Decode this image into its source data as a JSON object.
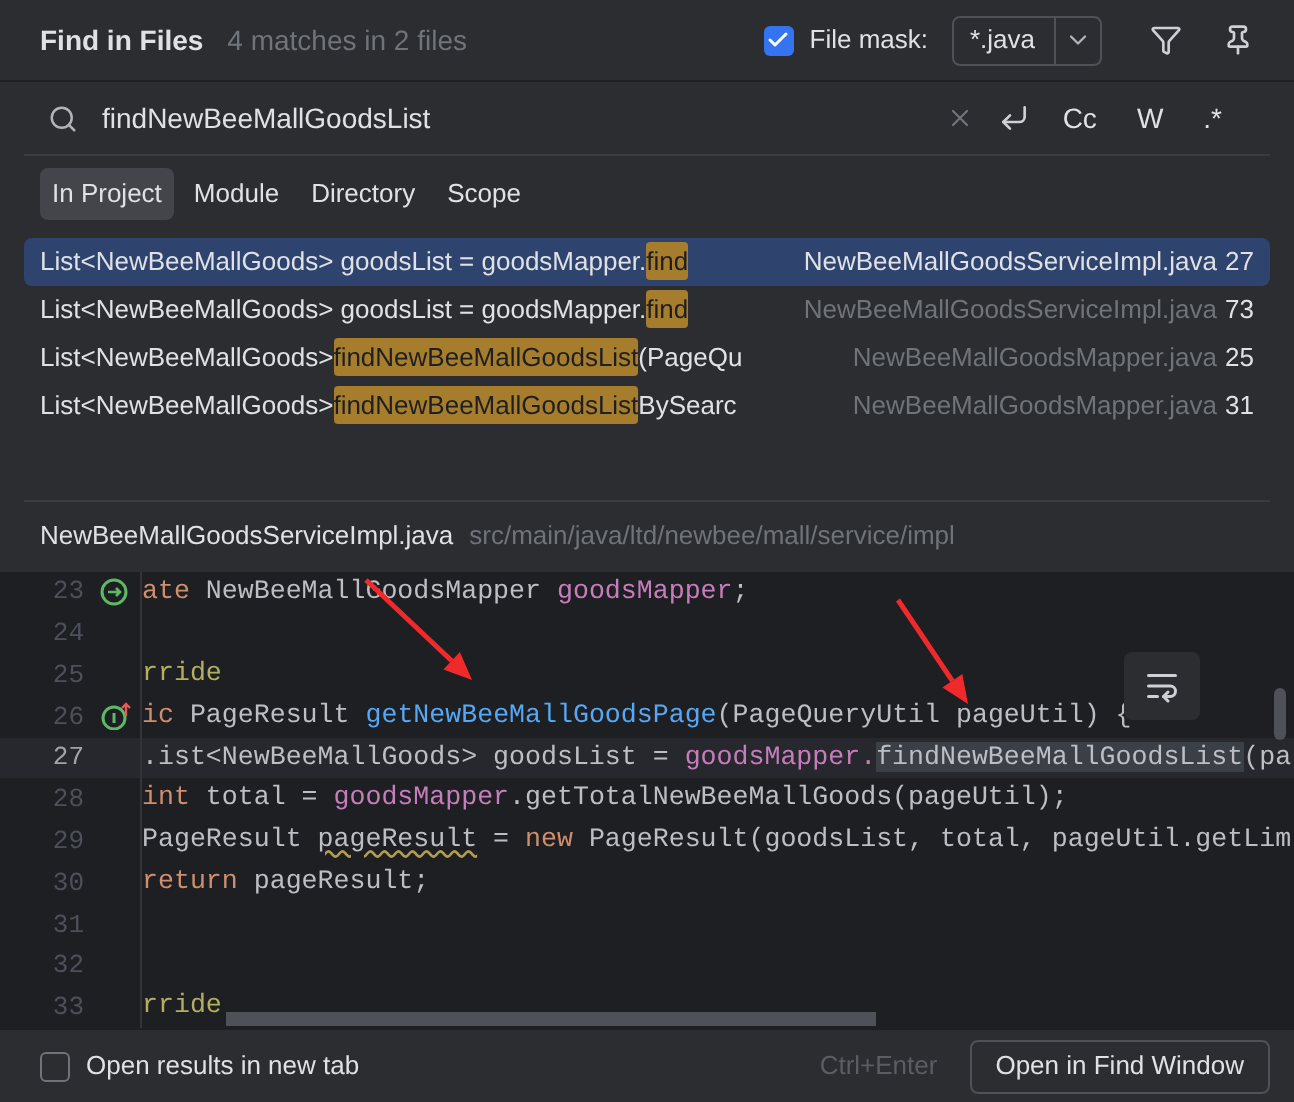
{
  "header": {
    "title": "Find in Files",
    "summary": "4 matches in 2 files",
    "file_mask": {
      "label": "File mask:",
      "checked": true,
      "value": "*.java"
    }
  },
  "search": {
    "value": "findNewBeeMallGoodsList",
    "options": [
      {
        "label": "Cc",
        "selected": false
      },
      {
        "label": "W",
        "selected": false
      },
      {
        "label": ".*",
        "selected": false
      }
    ]
  },
  "scopes": [
    {
      "label": "In Project",
      "selected": true
    },
    {
      "label": "Module",
      "selected": false
    },
    {
      "label": "Directory",
      "selected": false
    },
    {
      "label": "Scope",
      "selected": false
    }
  ],
  "results": [
    {
      "prefix": "List<NewBeeMallGoods> goodsList = goodsMapper.",
      "match": "find",
      "file": "NewBeeMallGoodsServiceImpl.java",
      "line": "27",
      "selected": true
    },
    {
      "prefix": "List<NewBeeMallGoods> goodsList = goodsMapper.",
      "match": "find",
      "file": "NewBeeMallGoodsServiceImpl.java",
      "line": "73",
      "selected": false
    },
    {
      "prefix": "List<NewBeeMallGoods> ",
      "match": "findNewBeeMallGoodsList",
      "suffix": "(PageQu",
      "file": "NewBeeMallGoodsMapper.java",
      "line": "25",
      "selected": false
    },
    {
      "prefix": "List<NewBeeMallGoods> ",
      "match": "findNewBeeMallGoodsList",
      "suffix": "BySearc",
      "file": "NewBeeMallGoodsMapper.java",
      "line": "31",
      "selected": false
    }
  ],
  "preview": {
    "file": "NewBeeMallGoodsServiceImpl.java",
    "path": "src/main/java/ltd/newbee/mall/service/impl",
    "lines": [
      {
        "number": "23",
        "current": false,
        "kind": "implements",
        "tokens": [
          {
            "kind": "keyword",
            "text": "ate "
          },
          {
            "kind": "plain",
            "text": "NewBeeMallGoodsMapper "
          },
          {
            "kind": "field",
            "text": "goodsMapper"
          },
          {
            "kind": "plain",
            "text": ";"
          }
        ]
      },
      {
        "number": "24",
        "current": false,
        "kind": "code"
      },
      {
        "number": "25",
        "current": false,
        "kind": "code",
        "tokens": [
          {
            "kind": "annotation",
            "text": "rride"
          }
        ]
      },
      {
        "number": "26",
        "current": false,
        "kind": "overrides",
        "tokens": [
          {
            "kind": "keyword",
            "text": "ic "
          },
          {
            "kind": "plain",
            "text": "PageResult "
          },
          {
            "kind": "method",
            "text": "getNewBeeMallGoodsPage"
          },
          {
            "kind": "plain",
            "text": "(PageQueryUtil pageUtil) {"
          }
        ]
      },
      {
        "number": "27",
        "current": true,
        "kind": "code",
        "tokens": [
          {
            "kind": "plain",
            "text": ".ist<NewBeeMallGoods> goodsList = "
          },
          {
            "kind": "field",
            "text": "goodsMapper."
          },
          {
            "kind": "match",
            "text": "findNewBeeMallGoodsList"
          },
          {
            "kind": "plain",
            "text": "(pa"
          }
        ]
      },
      {
        "number": "28",
        "current": false,
        "kind": "code",
        "tokens": [
          {
            "kind": "keyword",
            "text": "int "
          },
          {
            "kind": "plain",
            "text": "total = "
          },
          {
            "kind": "field",
            "text": "goodsMapper"
          },
          {
            "kind": "plain",
            "text": ".getTotalNewBeeMallGoods(pageUtil);"
          }
        ]
      },
      {
        "number": "29",
        "current": false,
        "kind": "code",
        "tokens": [
          {
            "kind": "plain",
            "text": "PageResult "
          },
          {
            "kind": "warning",
            "text": "pageResult"
          },
          {
            "kind": "plain",
            "text": " = "
          },
          {
            "kind": "keyword",
            "text": "new "
          },
          {
            "kind": "plain",
            "text": "PageResult(goodsList, total, pageUtil.getLim"
          }
        ]
      },
      {
        "number": "30",
        "current": false,
        "kind": "code",
        "tokens": [
          {
            "kind": "keyword",
            "text": "return "
          },
          {
            "kind": "plain",
            "text": "pageResult;"
          }
        ]
      },
      {
        "number": "31",
        "current": false,
        "kind": "code"
      },
      {
        "number": "32",
        "current": false,
        "kind": "code"
      },
      {
        "number": "33",
        "current": false,
        "kind": "code",
        "tokens": [
          {
            "kind": "annotation",
            "text": "rride"
          }
        ]
      }
    ]
  },
  "footer": {
    "new_tab": {
      "label": "Open results in new tab",
      "checked": false
    },
    "shortcut": "Ctrl+Enter",
    "button": "Open in Find Window"
  }
}
